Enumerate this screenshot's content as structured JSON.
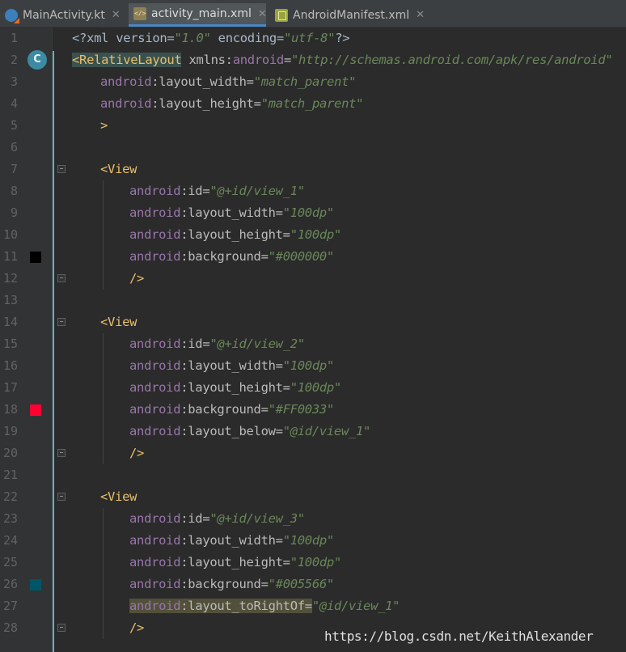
{
  "tabs": [
    {
      "label": "MainActivity.kt",
      "icon": "kotlin-file-icon",
      "active": false
    },
    {
      "label": "activity_main.xml",
      "icon": "xml-layout-file-icon",
      "active": true
    },
    {
      "label": "AndroidManifest.xml",
      "icon": "manifest-file-icon",
      "active": false
    }
  ],
  "close_glyph": "✕",
  "line_numbers": [
    "1",
    "2",
    "3",
    "4",
    "5",
    "6",
    "7",
    "8",
    "9",
    "10",
    "11",
    "12",
    "13",
    "14",
    "15",
    "16",
    "17",
    "18",
    "19",
    "20",
    "21",
    "22",
    "23",
    "24",
    "25",
    "26",
    "27",
    "28"
  ],
  "gutter": {
    "class_badge": "C",
    "color_swatches": {
      "11": "#000000",
      "18": "#FF0033",
      "26": "#005566"
    }
  },
  "code": {
    "l1": {
      "open": "<?xml version=",
      "v1": "\"1.0\"",
      "mid": " encoding=",
      "v2": "\"utf-8\"",
      "close": "?>"
    },
    "l2": {
      "tag": "<RelativeLayout",
      "sp": " xmlns:",
      "ns": "android",
      "eq": "=",
      "val": "\"http://schemas.android.com/apk/res/android\""
    },
    "l3": {
      "ns": "android",
      "attr": ":layout_width=",
      "val": "\"match_parent\""
    },
    "l4": {
      "ns": "android",
      "attr": ":layout_height=",
      "val": "\"match_parent\""
    },
    "l5": {
      "tag": ">"
    },
    "l7": {
      "tag": "<View"
    },
    "l8": {
      "ns": "android",
      "attr": ":id=",
      "val": "\"@+id/view_1\""
    },
    "l9": {
      "ns": "android",
      "attr": ":layout_width=",
      "val": "\"100dp\""
    },
    "l10": {
      "ns": "android",
      "attr": ":layout_height=",
      "val": "\"100dp\""
    },
    "l11": {
      "ns": "android",
      "attr": ":background=",
      "val": "\"#000000\""
    },
    "l12": {
      "tag": "/>"
    },
    "l14": {
      "tag": "<View"
    },
    "l15": {
      "ns": "android",
      "attr": ":id=",
      "val": "\"@+id/view_2\""
    },
    "l16": {
      "ns": "android",
      "attr": ":layout_width=",
      "val": "\"100dp\""
    },
    "l17": {
      "ns": "android",
      "attr": ":layout_height=",
      "val": "\"100dp\""
    },
    "l18": {
      "ns": "android",
      "attr": ":background=",
      "val": "\"#FF0033\""
    },
    "l19": {
      "ns": "android",
      "attr": ":layout_below=",
      "val": "\"@id/view_1\""
    },
    "l20": {
      "tag": "/>"
    },
    "l22": {
      "tag": "<View"
    },
    "l23": {
      "ns": "android",
      "attr": ":id=",
      "val": "\"@+id/view_3\""
    },
    "l24": {
      "ns": "android",
      "attr": ":layout_width=",
      "val": "\"100dp\""
    },
    "l25": {
      "ns": "android",
      "attr": ":layout_height=",
      "val": "\"100dp\""
    },
    "l26": {
      "ns": "android",
      "attr": ":background=",
      "val": "\"#005566\""
    },
    "l27": {
      "ns": "android",
      "attr": ":layout_toRightOf=",
      "val": "\"@id/view_1\""
    },
    "l28": {
      "tag": "/>"
    }
  },
  "watermark": "https://blog.csdn.net/KeithAlexander",
  "colors": {
    "editor_bg": "#2b2b2b",
    "tag": "#e8bf6a",
    "namespace": "#9876aa",
    "value": "#6a8759",
    "line_number": "#606366"
  }
}
